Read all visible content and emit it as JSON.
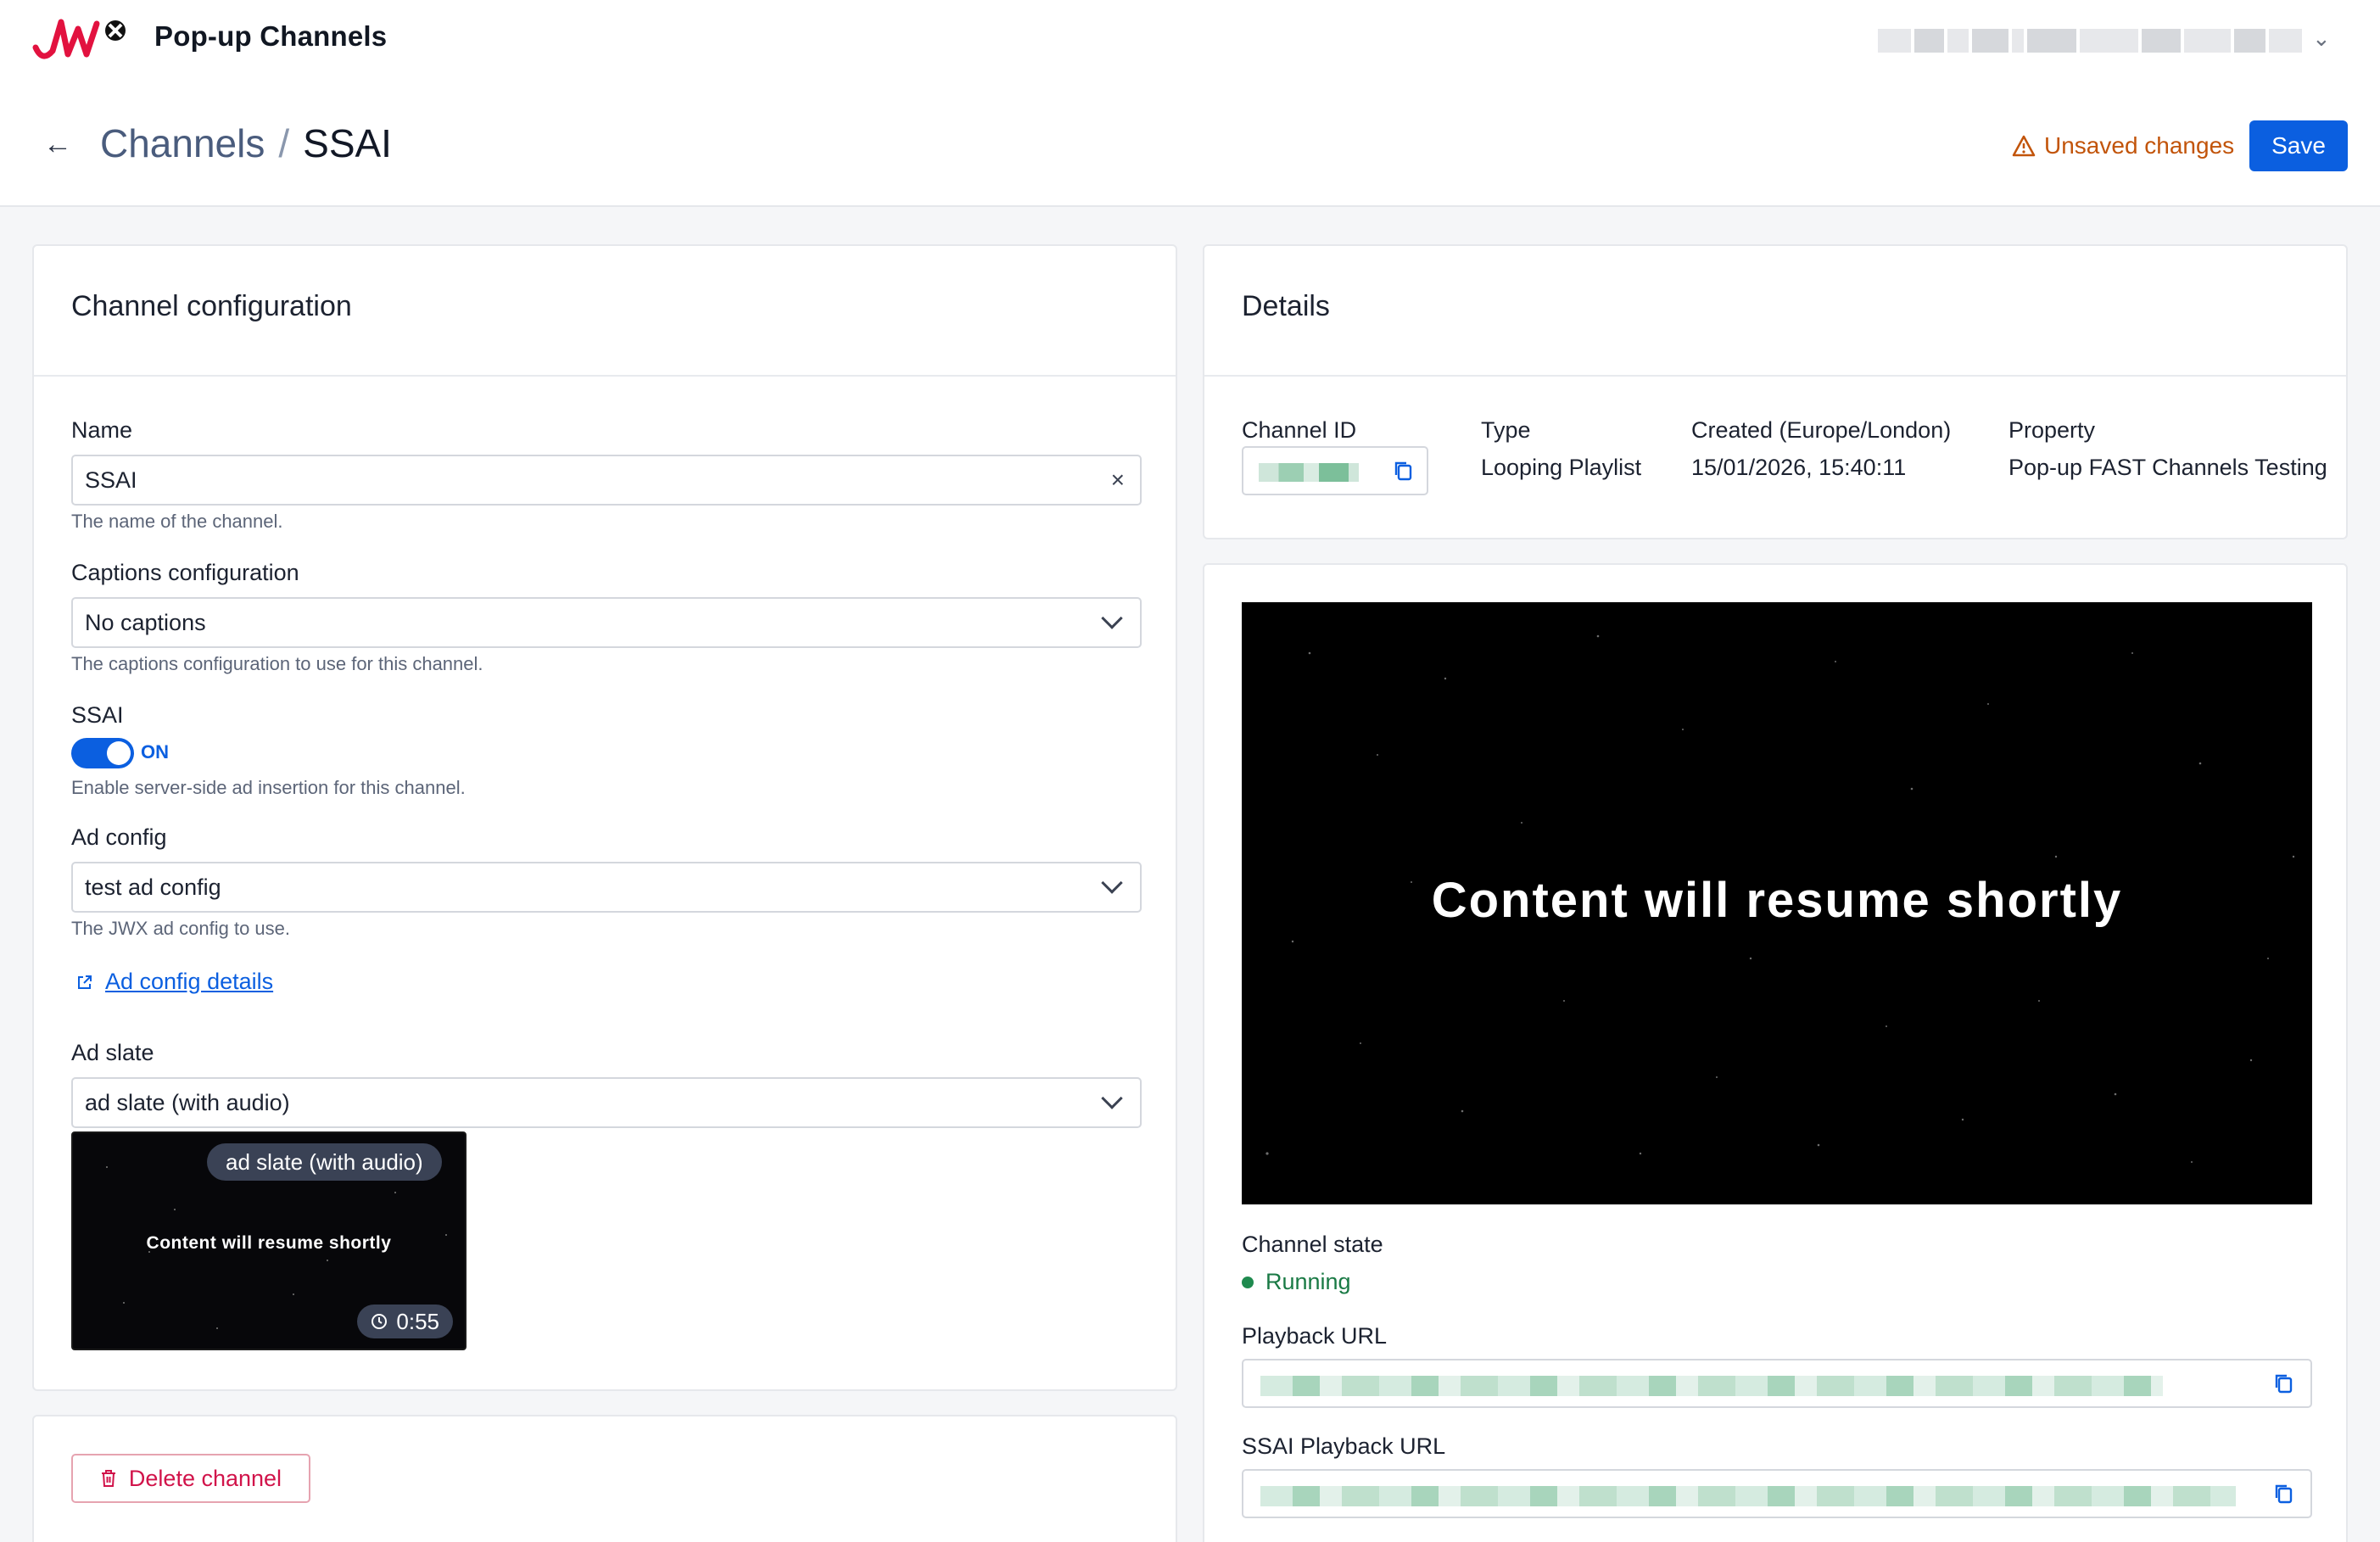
{
  "topbar": {
    "app_title": "Pop-up Channels",
    "logo_name": "JW"
  },
  "header": {
    "breadcrumb_parent": "Channels",
    "breadcrumb_separator": "/",
    "breadcrumb_current": "SSAI",
    "unsaved_label": "Unsaved changes",
    "save_label": "Save"
  },
  "config": {
    "title": "Channel configuration",
    "name": {
      "label": "Name",
      "value": "SSAI",
      "help": "The name of the channel."
    },
    "captions": {
      "label": "Captions configuration",
      "value": "No captions",
      "help": "The captions configuration to use for this channel."
    },
    "ssai": {
      "label": "SSAI",
      "state": "ON",
      "enabled": true,
      "help": "Enable server-side ad insertion for this channel."
    },
    "ad_config": {
      "label": "Ad config",
      "value": "test ad config",
      "help": "The JWX ad config to use.",
      "link_label": "Ad config details"
    },
    "ad_slate": {
      "label": "Ad slate",
      "value": "ad slate (with audio)",
      "thumb_chip": "ad slate (with audio)",
      "thumb_text": "Content will resume shortly",
      "thumb_duration": "0:55"
    }
  },
  "danger": {
    "delete_label": "Delete channel"
  },
  "details": {
    "title": "Details",
    "channel_id_label": "Channel ID",
    "type_label": "Type",
    "type_value": "Looping Playlist",
    "created_label": "Created (Europe/London)",
    "created_value": "15/01/2026, 15:40:11",
    "property_label": "Property",
    "property_value": "Pop-up FAST Channels Testing"
  },
  "preview": {
    "video_text": "Content will resume shortly",
    "channel_state_label": "Channel state",
    "channel_state_value": "Running",
    "playback_url_label": "Playback URL",
    "ssai_playback_url_label": "SSAI Playback URL"
  },
  "colors": {
    "accent": "#0b5fe0",
    "warning": "#c2540a",
    "danger": "#d1134a",
    "success": "#1f8a4f"
  },
  "icons": [
    "logo-icon",
    "chevron-down-icon",
    "back-arrow-icon",
    "warning-icon",
    "clear-icon",
    "external-link-icon",
    "clock-icon",
    "trash-icon",
    "copy-icon"
  ]
}
